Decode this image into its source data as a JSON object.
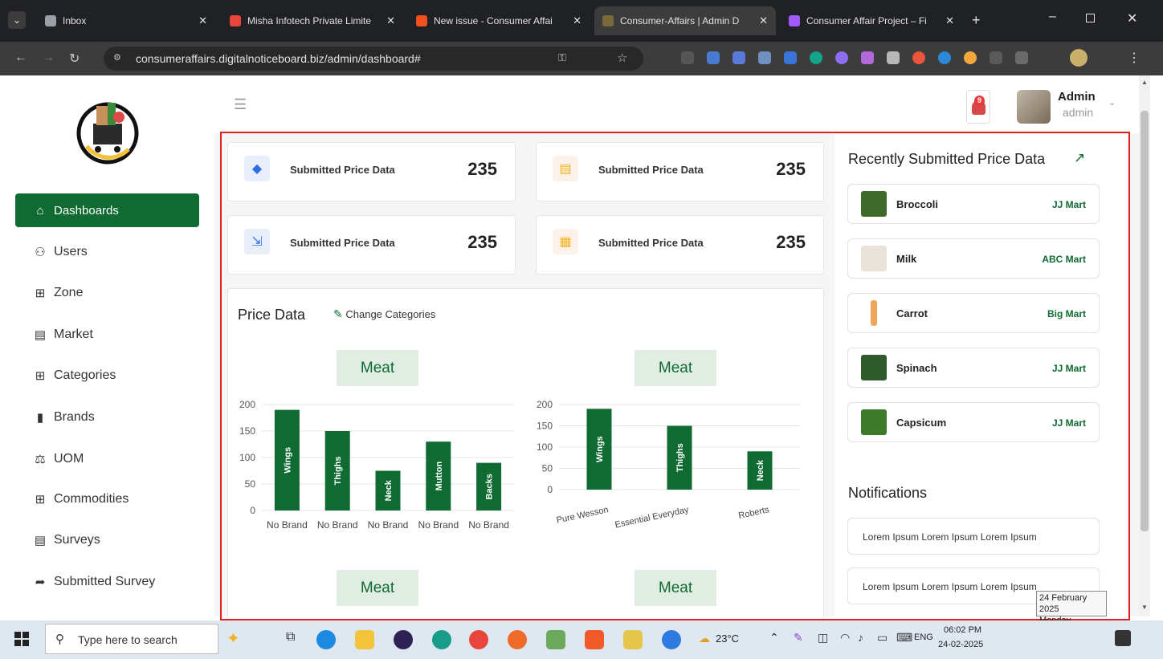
{
  "browser": {
    "tabs": [
      {
        "title": "Inbox",
        "color": "#9aa0a6"
      },
      {
        "title": "Misha Infotech Private Limite",
        "color": "#e8453c"
      },
      {
        "title": "New issue - Consumer Affai",
        "color": "#f24e1e"
      },
      {
        "title": "Consumer-Affairs | Admin D",
        "color": "#7a6a3a"
      },
      {
        "title": "Consumer Affair Project – Fi",
        "color": "#a259ff"
      }
    ],
    "url": "consumeraffairs.digitalnoticeboard.biz/admin/dashboard#"
  },
  "sidebar": {
    "items": [
      {
        "label": "Dashboards",
        "icon": "home-icon",
        "glyph": "⌂"
      },
      {
        "label": "Users",
        "icon": "users-icon",
        "glyph": "👥"
      },
      {
        "label": "Zone",
        "icon": "grid-icon",
        "glyph": "⊞"
      },
      {
        "label": "Market",
        "icon": "store-icon",
        "glyph": "▦"
      },
      {
        "label": "Categories",
        "icon": "grid-icon",
        "glyph": "⊞"
      },
      {
        "label": "Brands",
        "icon": "badge-icon",
        "glyph": "▮"
      },
      {
        "label": "UOM",
        "icon": "scale-icon",
        "glyph": "⚖"
      },
      {
        "label": "Commodities",
        "icon": "grid-icon",
        "glyph": "⊞"
      },
      {
        "label": "Surveys",
        "icon": "list-icon",
        "glyph": "▤"
      },
      {
        "label": "Submitted Survey",
        "icon": "file-export-icon",
        "glyph": "➦"
      }
    ]
  },
  "header": {
    "notification_count": "9",
    "user_name": "Admin",
    "user_role": "admin"
  },
  "stats": [
    {
      "label": "Submitted Price Data",
      "value": "235",
      "icon": "tag-icon",
      "glyph": "🏷",
      "color": "#2f6fe0",
      "bg": "#e8effb"
    },
    {
      "label": "Submitted Price Data",
      "value": "235",
      "icon": "document-icon",
      "glyph": "▤",
      "color": "#f5b21f",
      "bg": "#fdf2ea"
    },
    {
      "label": "Submitted Price Data",
      "value": "235",
      "icon": "file-export-icon",
      "glyph": "⇲",
      "color": "#2f6fe0",
      "bg": "#e8effb"
    },
    {
      "label": "Submitted Price Data",
      "value": "235",
      "icon": "widgets-icon",
      "glyph": "▦",
      "color": "#f5b21f",
      "bg": "#fdf2ea"
    }
  ],
  "price_data": {
    "title": "Price Data",
    "change_label": "Change Categories",
    "category_labels": [
      "Meat",
      "Meat",
      "Meat",
      "Meat"
    ]
  },
  "chart_data": [
    {
      "type": "bar",
      "categories": [
        "No Brand",
        "No Brand",
        "No Brand",
        "No Brand",
        "No Brand"
      ],
      "bar_labels": [
        "Wings",
        "Thighs",
        "Neck",
        "Mutton",
        "Backs"
      ],
      "values": [
        190,
        150,
        75,
        130,
        90
      ],
      "ylim": [
        0,
        200
      ],
      "yticks": [
        0,
        50,
        100,
        150,
        200
      ],
      "color": "#0f6b32"
    },
    {
      "type": "bar",
      "categories": [
        "Pure Wesson",
        "Essential Everyday",
        "Roberts"
      ],
      "bar_labels": [
        "Wings",
        "Thighs",
        "Neck"
      ],
      "values": [
        190,
        150,
        90
      ],
      "ylim": [
        0,
        200
      ],
      "yticks": [
        0,
        50,
        100,
        150,
        200
      ],
      "color": "#0f6b32"
    }
  ],
  "recent": {
    "title": "Recently Submitted Price Data",
    "items": [
      {
        "name": "Broccoli",
        "market": "JJ Mart",
        "thumb": "#3f6b2a"
      },
      {
        "name": "Milk",
        "market": "ABC Mart",
        "thumb": "#e9e2d8"
      },
      {
        "name": "Carrot",
        "market": "Big Mart",
        "thumb": "#f0a55a"
      },
      {
        "name": "Spinach",
        "market": "JJ Mart",
        "thumb": "#2f5a2c"
      },
      {
        "name": "Capsicum",
        "market": "JJ Mart",
        "thumb": "#3d7a2a"
      }
    ]
  },
  "notifications": {
    "title": "Notifications",
    "items": [
      "Lorem Ipsum Lorem Ipsum Lorem Ipsum",
      "Lorem Ipsum Lorem Ipsum Lorem Ipsum"
    ]
  },
  "tooltip": {
    "date": "24 February 2025",
    "day": "Monday"
  },
  "taskbar": {
    "search_placeholder": "Type here to search",
    "weather": "23°C",
    "language": "ENG",
    "time": "06:02 PM",
    "date": "24-02-2025"
  }
}
